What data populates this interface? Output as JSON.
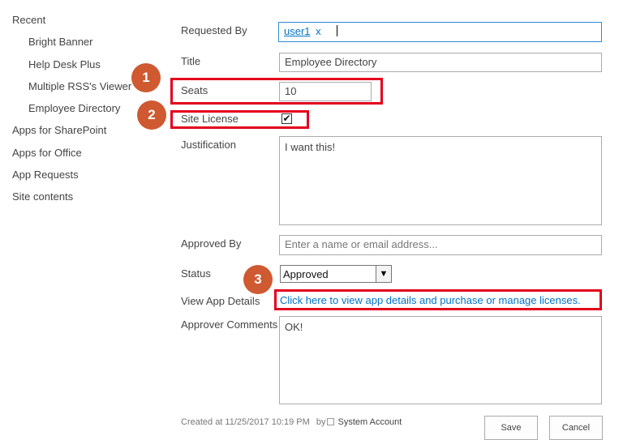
{
  "nav": {
    "recent_heading": "Recent",
    "recent_items": [
      "Bright Banner",
      "Help Desk Plus",
      "Multiple RSS's Viewer",
      "Employee Directory"
    ],
    "links": [
      "Apps for SharePoint",
      "Apps for Office",
      "App Requests",
      "Site contents"
    ]
  },
  "form": {
    "requested_by": {
      "label": "Requested By",
      "user": "user1",
      "remove": "x"
    },
    "title": {
      "label": "Title",
      "value": "Employee Directory"
    },
    "seats": {
      "label": "Seats",
      "value": "10"
    },
    "site_license": {
      "label": "Site License",
      "checked_glyph": "✔",
      "checked": true
    },
    "justification": {
      "label": "Justification",
      "value": "I want this!"
    },
    "approved_by": {
      "label": "Approved By",
      "placeholder": "Enter a name or email address..."
    },
    "status": {
      "label": "Status",
      "value": "Approved",
      "arrow": "▼"
    },
    "view_app_details": {
      "label": "View App Details",
      "link": "Click here to view app details and purchase or manage licenses."
    },
    "approver_comments": {
      "label": "Approver Comments",
      "value": "OK!"
    }
  },
  "callouts": [
    "1",
    "2",
    "3"
  ],
  "footer": {
    "created_at": "Created at 11/25/2017 10:19 PM",
    "by": "by",
    "user": "System Account"
  },
  "buttons": {
    "save": "Save",
    "cancel": "Cancel"
  },
  "colors": {
    "highlight": "#e3001b",
    "callout": "#cf5930",
    "link": "#0072c6",
    "focus_border": "#2a8dd4"
  }
}
